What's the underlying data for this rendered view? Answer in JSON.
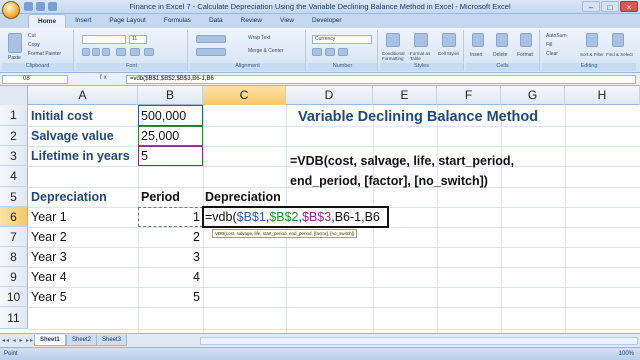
{
  "window": {
    "title": "Finance in Excel 7 - Calculate Depreciation Using the Variable Declining Balance Method in Excel - Microsoft Excel"
  },
  "ribbon": {
    "tabs": [
      "Home",
      "Insert",
      "Page Layout",
      "Formulas",
      "Data",
      "Review",
      "View",
      "Developer"
    ],
    "active_tab": "Home",
    "groups": {
      "clipboard": {
        "label": "Clipboard",
        "cut": "Cut",
        "copy": "Copy",
        "format_painter": "Format Painter",
        "paste": "Paste"
      },
      "font": {
        "label": "Font",
        "font_size": "11"
      },
      "alignment": {
        "label": "Alignment",
        "wrap_text": "Wrap Text",
        "merge": "Merge & Center"
      },
      "number": {
        "label": "Number",
        "format": "Currency"
      },
      "styles": {
        "label": "Styles",
        "conditional": "Conditional Formatting",
        "format_table": "Format as Table",
        "cell_styles": "Cell Styles"
      },
      "cells": {
        "label": "Cells",
        "insert": "Insert",
        "delete": "Delete",
        "format": "Format"
      },
      "editing": {
        "label": "Editing",
        "autosum": "AutoSum",
        "fill": "Fill",
        "clear": "Clear",
        "sort_filter": "Sort & Filter",
        "find_select": "Find & Select"
      }
    }
  },
  "formula_bar": {
    "name_box": "08",
    "fx": "fx",
    "content": "=vdb($B$1,$B$2,$B$3,B6-1,B6"
  },
  "grid": {
    "columns": [
      "A",
      "B",
      "C",
      "D",
      "E",
      "F",
      "G",
      "H"
    ],
    "rows": [
      "1",
      "2",
      "3",
      "4",
      "5",
      "6",
      "7",
      "8",
      "9",
      "10",
      "11"
    ],
    "selected_column": "C",
    "selected_row": "6"
  },
  "cells": {
    "A1": "Initial cost",
    "B1": "500,000",
    "A2": "Salvage value",
    "B2": "25,000",
    "A3": "Lifetime in years",
    "B3": "5",
    "D2": "Variable Declining Balance Method",
    "D4": "=VDB(cost, salvage, life, start_period,",
    "D5": "end_period, [factor], [no_switch])",
    "A5": "Depreciation",
    "B5": "Period",
    "C5": "Depreciation",
    "A6": "Year 1",
    "B6": "1",
    "A7": "Year 2",
    "B7": "2",
    "A8": "Year 3",
    "B8": "3",
    "A9": "Year 4",
    "B9": "4",
    "A10": "Year 5",
    "B10": "5"
  },
  "edit": {
    "prefix": "=vdb(",
    "ref1": "$B$1",
    "sep1": ",",
    "ref2": "$B$2",
    "sep2": ",",
    "ref3": "$B$3",
    "sep3": ",",
    "ref4": "B6-1",
    "sep4": ",",
    "ref5": "B6",
    "tooltip": "VDB(cost, salvage, life, start_period, end_period, [factor], [no_switch])"
  },
  "sheets": {
    "tabs": [
      "Sheet1",
      "Sheet2",
      "Sheet3"
    ],
    "active": "Sheet1"
  },
  "status": {
    "mode": "Point",
    "zoom": "100%"
  },
  "colors": {
    "header_blue": "#1f497d",
    "ref_blue": "#2a55c6",
    "ref_green": "#2f8a2f",
    "ref_purple": "#8a2c8a",
    "ref_orange": "#c97a10"
  }
}
